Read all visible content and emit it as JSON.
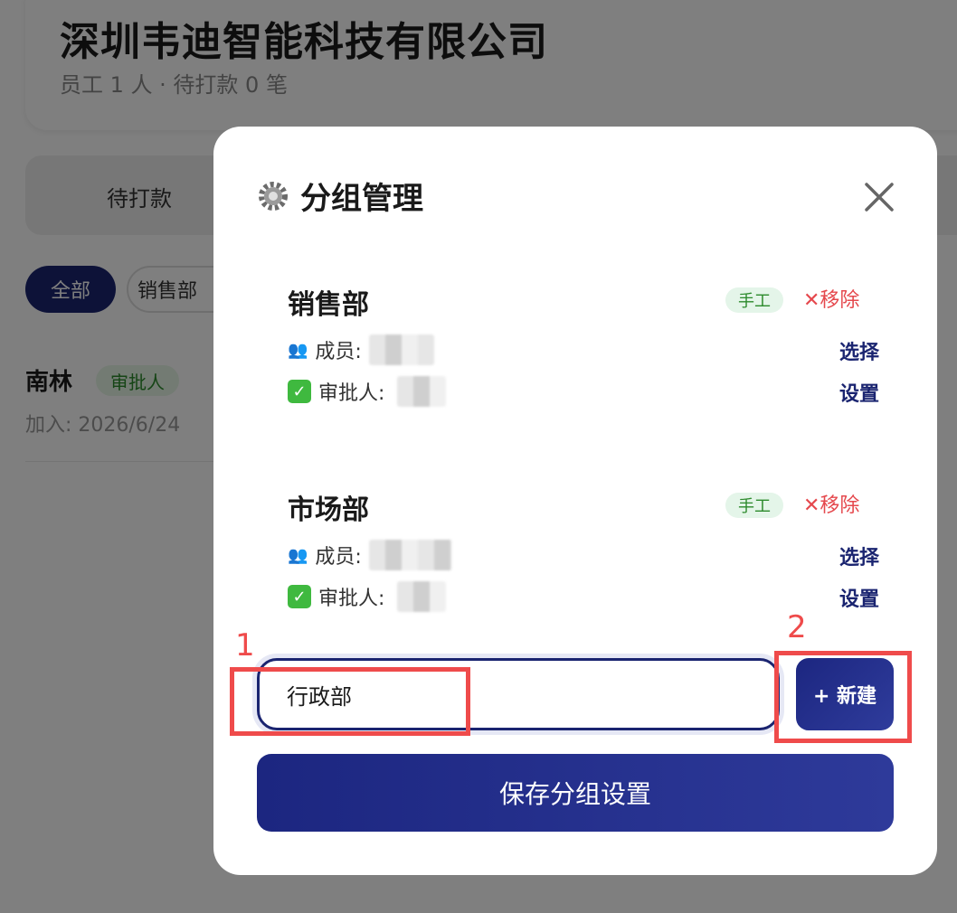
{
  "page": {
    "company_name": "深圳韦迪智能科技有限公司",
    "company_sub": "员工 1 人 · 待打款 0 笔",
    "tab_pending": "待打款",
    "chips": [
      "全部",
      "销售部"
    ],
    "employee": {
      "name": "南林",
      "badge": "审批人",
      "join_text": "加入: 2026/6/24"
    }
  },
  "modal": {
    "icon": "gear-icon",
    "title": "分组管理",
    "close_icon": "close-icon",
    "groups": [
      {
        "name": "销售部",
        "tag": "手工",
        "remove_label": "✕移除",
        "members_label": "成员:",
        "approver_label": "审批人:",
        "select_label": "选择",
        "set_label": "设置"
      },
      {
        "name": "市场部",
        "tag": "手工",
        "remove_label": "✕移除",
        "members_label": "成员:",
        "approver_label": "审批人:",
        "select_label": "选择",
        "set_label": "设置"
      }
    ],
    "new_group_input_value": "行政部",
    "new_button_label": "+ 新建",
    "save_button_label": "保存分组设置"
  },
  "annotations": [
    "1",
    "2"
  ],
  "colors": {
    "primary": "#1a2470",
    "danger": "#e5484d",
    "tag_green": "#2c8a2c",
    "annotation_red": "#ef4b4b"
  }
}
